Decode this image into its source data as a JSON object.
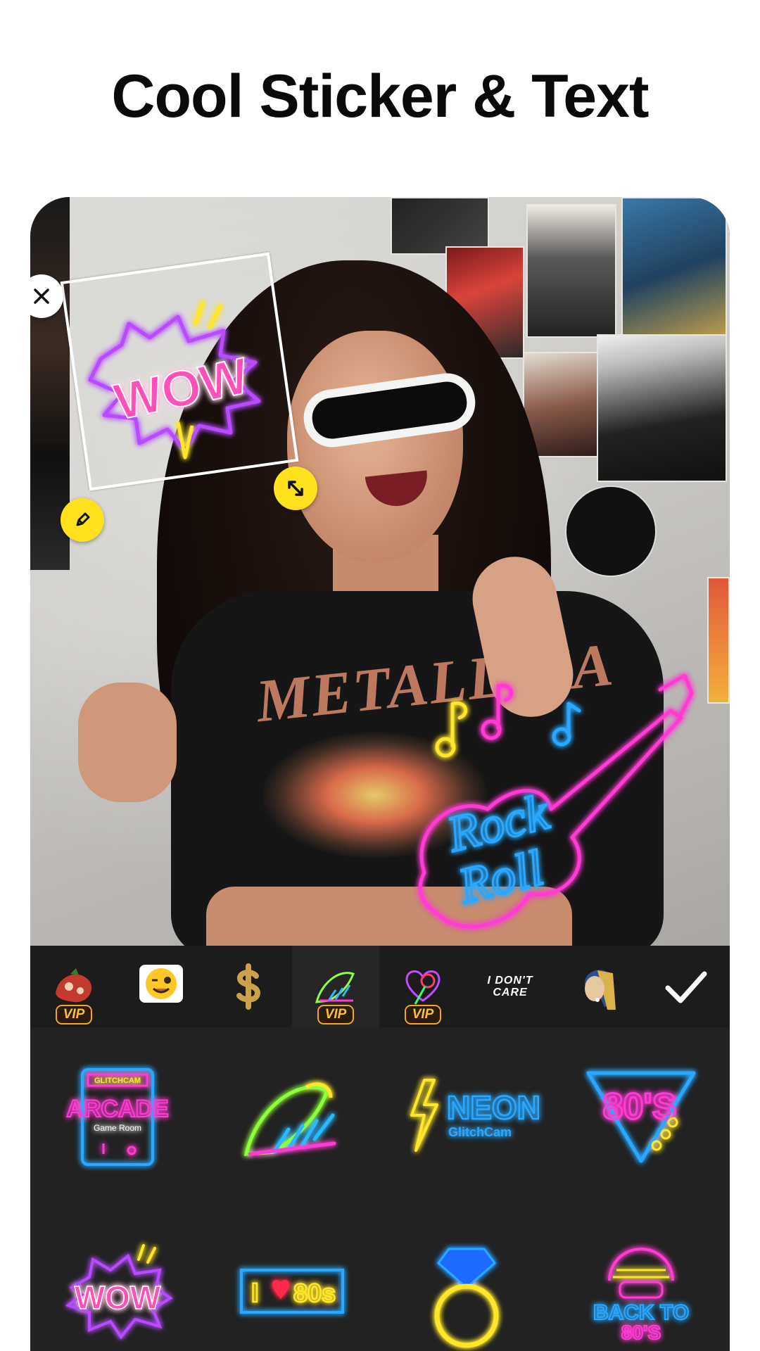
{
  "headline": "Cool Sticker & Text",
  "photo_stickers": {
    "wow_text": "WOW",
    "rock_line1": "Rock",
    "rock_line2": "Roll"
  },
  "categories": [
    {
      "name": "fruit-sticker",
      "vip": "VIP"
    },
    {
      "name": "emoji-sticker",
      "vip": ""
    },
    {
      "name": "gold-dollar-sticker",
      "vip": ""
    },
    {
      "name": "neon-wing-sticker",
      "vip": "VIP"
    },
    {
      "name": "neon-rose-sticker",
      "vip": "VIP"
    },
    {
      "name": "i-dont-care-sticker",
      "text_line1": "I DON'T",
      "text_line2": "CARE"
    },
    {
      "name": "pearl-earring-sticker",
      "vip": ""
    }
  ],
  "grid": {
    "arcade_top": "GLITCHCAM",
    "arcade_main": "ARCADE",
    "arcade_sub": "Game Room",
    "neon_main": "NEON",
    "neon_sub": "GlitchCam",
    "eighties": "80'S",
    "wow": "WOW",
    "love_prefix": "I",
    "love_suffix": "80s",
    "back_line1": "BACK TO",
    "back_line2": "80'S"
  },
  "colors": {
    "accent_yellow": "#ffe11e",
    "vip_orange": "#f4a52a",
    "neon_pink": "#ff3bd4",
    "neon_blue": "#2aa8ff",
    "neon_yellow": "#ffe62a"
  }
}
